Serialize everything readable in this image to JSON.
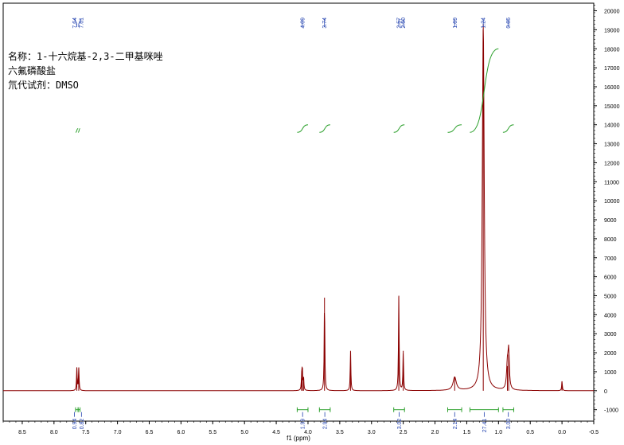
{
  "annotation": {
    "name_line1": "名称：1-十六烷基-2,3-二甲基咪唑",
    "name_line2": "六氟磷酸盐",
    "solvent": "氘代试剂：DMSO"
  },
  "colors": {
    "spectrum": "#8b0000",
    "integral": "#2ca02c",
    "peak_label": "#1f3fae",
    "integral_label": "#1f3fae"
  },
  "chart_data": {
    "type": "line",
    "title": "",
    "xlabel": "f1 (ppm)",
    "ylabel": "",
    "x_reversed": true,
    "xlim": [
      8.8,
      -0.5
    ],
    "ylim": [
      -1600,
      20400
    ],
    "x_ticks": [
      "8.5",
      "8.0",
      "7.5",
      "7.0",
      "6.5",
      "6.0",
      "5.5",
      "5.0",
      "4.5",
      "4.0",
      "3.5",
      "3.0",
      "2.5",
      "2.0",
      "1.5",
      "1.0",
      "0.5",
      "0.0",
      "-0.5"
    ],
    "y_ticks": [
      "20000",
      "19000",
      "18000",
      "17000",
      "16000",
      "15000",
      "14000",
      "13000",
      "12000",
      "11000",
      "10000",
      "9000",
      "8000",
      "7000",
      "6000",
      "5000",
      "4000",
      "3000",
      "2000",
      "1000",
      "0",
      "-1000"
    ],
    "peaks": [
      {
        "ppm": 7.64,
        "height": 1200,
        "width": 0.006
      },
      {
        "ppm": 7.61,
        "height": 1200,
        "width": 0.006
      },
      {
        "ppm": 4.1,
        "height": 650,
        "width": 0.006
      },
      {
        "ppm": 4.09,
        "height": 1200,
        "width": 0.006
      },
      {
        "ppm": 4.07,
        "height": 650,
        "width": 0.006
      },
      {
        "ppm": 3.74,
        "height": 4900,
        "width": 0.006
      },
      {
        "ppm": 3.33,
        "height": 2100,
        "width": 0.006
      },
      {
        "ppm": 2.57,
        "height": 5000,
        "width": 0.006
      },
      {
        "ppm": 2.5,
        "height": 2100,
        "width": 0.006
      },
      {
        "ppm": 1.69,
        "height": 700,
        "width": 0.03
      },
      {
        "ppm": 1.24,
        "height": 19300,
        "width": 0.018
      },
      {
        "ppm": 0.86,
        "height": 1300,
        "width": 0.015
      },
      {
        "ppm": 0.84,
        "height": 1900,
        "width": 0.012
      },
      {
        "ppm": 0.0,
        "height": 500,
        "width": 0.006
      }
    ],
    "peak_labels": [
      "7.64",
      "7.61",
      "4.09",
      "3.74",
      "2.57",
      "2.50",
      "1.69",
      "1.24",
      "0.85"
    ],
    "peak_label_ppm": [
      7.64,
      7.61,
      4.09,
      3.74,
      2.57,
      2.5,
      1.69,
      1.24,
      0.85
    ],
    "integrals": [
      {
        "label": "0.94",
        "from": 7.66,
        "to": 7.62,
        "y0": 13600,
        "y1": 13800
      },
      {
        "label": "0.82",
        "from": 7.62,
        "to": 7.59,
        "y0": 13600,
        "y1": 13800
      },
      {
        "label": "1.99",
        "from": 4.17,
        "to": 4.0,
        "y0": 13600,
        "y1": 14000
      },
      {
        "label": "2.94",
        "from": 3.82,
        "to": 3.65,
        "y0": 13600,
        "y1": 14000
      },
      {
        "label": "3.02",
        "from": 2.65,
        "to": 2.48,
        "y0": 13600,
        "y1": 14000
      },
      {
        "label": "2.14",
        "from": 1.8,
        "to": 1.58,
        "y0": 13600,
        "y1": 14000
      },
      {
        "label": "27.41",
        "from": 1.45,
        "to": 1.0,
        "y0": 13600,
        "y1": 18000
      },
      {
        "label": "3.00",
        "from": 0.93,
        "to": 0.76,
        "y0": 13600,
        "y1": 14000
      }
    ]
  }
}
